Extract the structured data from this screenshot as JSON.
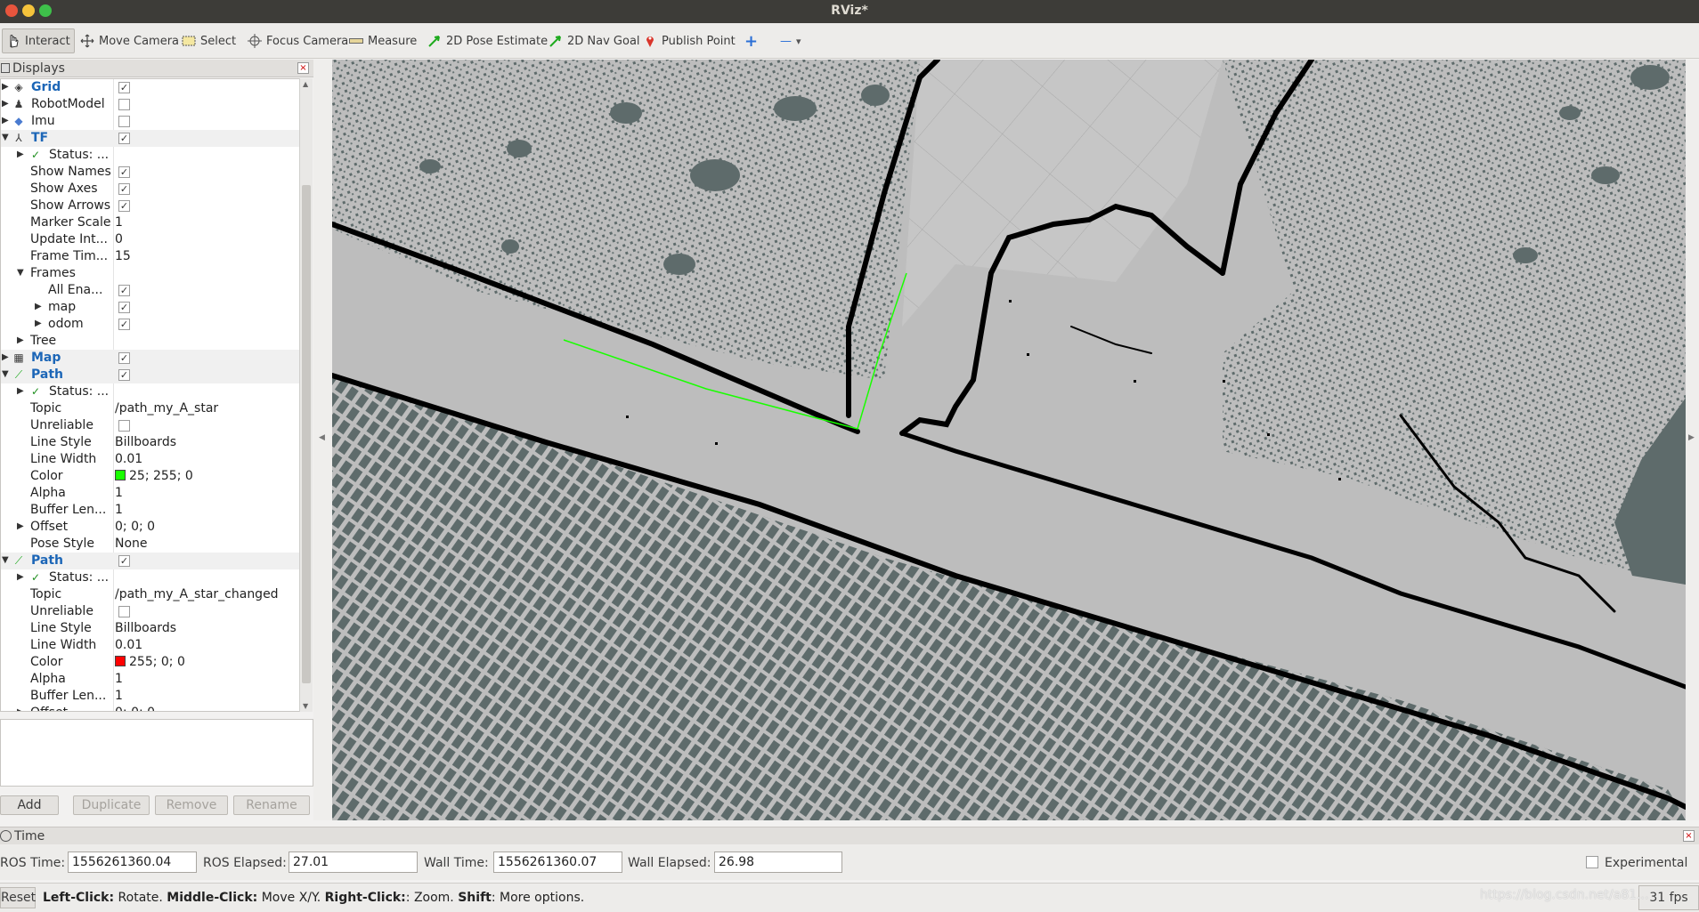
{
  "window": {
    "title": "RViz*"
  },
  "toolbar": {
    "interact": "Interact",
    "move_camera": "Move Camera",
    "select": "Select",
    "focus_camera": "Focus Camera",
    "measure": "Measure",
    "pose_estimate": "2D Pose Estimate",
    "nav_goal": "2D Nav Goal",
    "publish_point": "Publish Point",
    "plus": "+",
    "minus": "—",
    "dropdown": "▾"
  },
  "displays": {
    "title": "Displays",
    "close": "×",
    "rows": {
      "grid": "Grid",
      "robotmodel": "RobotModel",
      "imu": "Imu",
      "tf": "TF",
      "tf_status": "Status: ...",
      "show_names": "Show Names",
      "show_axes": "Show Axes",
      "show_arrows": "Show Arrows",
      "marker_scale": "Marker Scale",
      "marker_scale_val": "1",
      "update_int": "Update Int...",
      "update_int_val": "0",
      "frame_tim": "Frame Tim...",
      "frame_tim_val": "15",
      "frames": "Frames",
      "all_ena": "All Ena...",
      "map_frame": "map",
      "odom": "odom",
      "tree": "Tree",
      "map": "Map",
      "path1": "Path",
      "path1_status": "Status: ...",
      "topic": "Topic",
      "path1_topic": "/path_my_A_star",
      "unreliable": "Unreliable",
      "line_style": "Line Style",
      "line_style_val": "Billboards",
      "line_width": "Line Width",
      "line_width_val": "0.01",
      "color": "Color",
      "path1_color": "25; 255; 0",
      "alpha": "Alpha",
      "alpha_val": "1",
      "buffer_len": "Buffer Len...",
      "buffer_len_val": "1",
      "offset": "Offset",
      "offset_val": "0; 0; 0",
      "pose_style": "Pose Style",
      "pose_style_val": "None",
      "path2": "Path",
      "path2_status": "Status: ...",
      "path2_topic": "/path_my_A_star_changed",
      "path2_color": "255; 0; 0"
    },
    "buttons": {
      "add": "Add",
      "duplicate": "Duplicate",
      "remove": "Remove",
      "rename": "Rename"
    },
    "colors": {
      "path1": "#19ff00",
      "path2": "#ff0000"
    }
  },
  "time": {
    "title": "Time",
    "close": "×",
    "ros_time_label": "ROS Time:",
    "ros_time": "1556261360.04",
    "ros_elapsed_label": "ROS Elapsed:",
    "ros_elapsed": "27.01",
    "wall_time_label": "Wall Time:",
    "wall_time": "1556261360.07",
    "wall_elapsed_label": "Wall Elapsed:",
    "wall_elapsed": "26.98",
    "experimental": "Experimental"
  },
  "status": {
    "reset": "Reset",
    "hint_left": "Left-Click:",
    "hint_left_action": " Rotate. ",
    "hint_middle": "Middle-Click:",
    "hint_middle_action": " Move X/Y. ",
    "hint_right": "Right-Click:",
    "hint_right_action": ": Zoom. ",
    "hint_shift": "Shift",
    "hint_shift_action": ": More options.",
    "fps": "31 fps",
    "watermark": "https://blog.csdn.net/a81..."
  },
  "map_colors": {
    "free": "#bdbdbd",
    "unknown": "#5e6b6b",
    "wall": "#000000",
    "path": "#19ff00"
  }
}
